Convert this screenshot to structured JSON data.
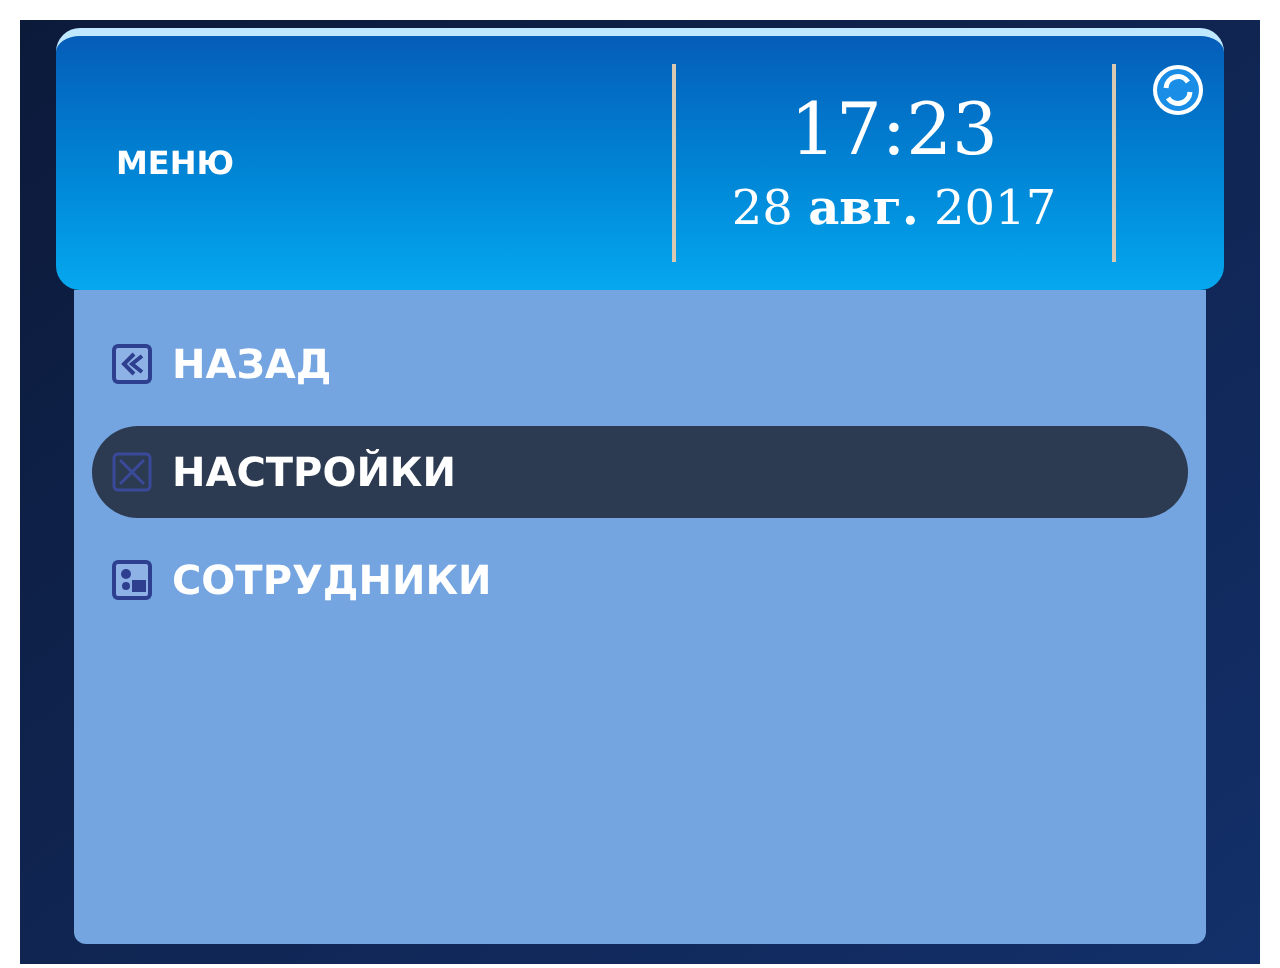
{
  "header": {
    "title": "МЕНЮ",
    "time": "17:23",
    "date": "28 **авг.** 2017"
  },
  "menu": [
    {
      "label": "НАЗАД",
      "kind": "back",
      "selected": false
    },
    {
      "label": "НАСТРОЙКИ",
      "kind": "settings",
      "selected": true
    },
    {
      "label": "СОТРУДНИКИ",
      "kind": "staff",
      "selected": false
    }
  ]
}
